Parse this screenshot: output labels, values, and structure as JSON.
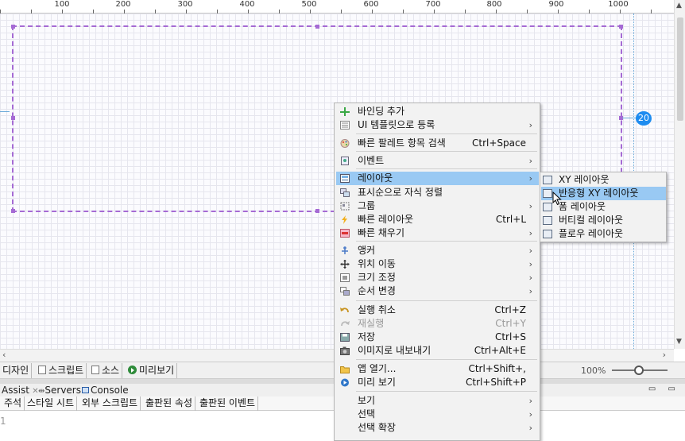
{
  "ruler": {
    "ticks": [
      "100",
      "200",
      "300",
      "400",
      "500",
      "600",
      "700",
      "800",
      "900",
      "1000"
    ]
  },
  "canvas": {
    "spacing_badge": "20"
  },
  "context_menu": {
    "groups": [
      [
        {
          "label": "바인딩 추가",
          "shortcut": "",
          "submenu": false,
          "icon": "plus-icon",
          "disabled": false
        },
        {
          "label": "UI 템플릿으로 등록",
          "shortcut": "",
          "submenu": true,
          "icon": "template-icon",
          "disabled": false
        }
      ],
      [
        {
          "label": "빠른 팔레트 항목 검색",
          "shortcut": "Ctrl+Space",
          "submenu": false,
          "icon": "palette-icon",
          "disabled": false
        }
      ],
      [
        {
          "label": "이벤트",
          "shortcut": "",
          "submenu": true,
          "icon": "event-icon",
          "disabled": false
        }
      ],
      [
        {
          "label": "레이아웃",
          "shortcut": "",
          "submenu": true,
          "icon": "layout-icon",
          "disabled": false,
          "highlighted": true
        },
        {
          "label": "표시순으로 자식 정렬",
          "shortcut": "",
          "submenu": false,
          "icon": "sort-icon",
          "disabled": false
        },
        {
          "label": "그룹",
          "shortcut": "",
          "submenu": true,
          "icon": "group-icon",
          "disabled": false
        },
        {
          "label": "빠른 레이아웃",
          "shortcut": "Ctrl+L",
          "submenu": false,
          "icon": "lightning-icon",
          "disabled": false
        },
        {
          "label": "빠른 채우기",
          "shortcut": "",
          "submenu": true,
          "icon": "fill-icon",
          "disabled": false
        }
      ],
      [
        {
          "label": "앵커",
          "shortcut": "",
          "submenu": true,
          "icon": "anchor-icon",
          "disabled": false
        },
        {
          "label": "위치 이동",
          "shortcut": "",
          "submenu": true,
          "icon": "move-icon",
          "disabled": false
        },
        {
          "label": "크기 조정",
          "shortcut": "",
          "submenu": true,
          "icon": "resize-icon",
          "disabled": false
        },
        {
          "label": "순서 변경",
          "shortcut": "",
          "submenu": true,
          "icon": "order-icon",
          "disabled": false
        }
      ],
      [
        {
          "label": "실행 취소",
          "shortcut": "Ctrl+Z",
          "submenu": false,
          "icon": "undo-icon",
          "disabled": false
        },
        {
          "label": "재실행",
          "shortcut": "Ctrl+Y",
          "submenu": false,
          "icon": "redo-icon",
          "disabled": true
        },
        {
          "label": "저장",
          "shortcut": "Ctrl+S",
          "submenu": false,
          "icon": "save-icon",
          "disabled": false
        },
        {
          "label": "이미지로 내보내기",
          "shortcut": "Ctrl+Alt+E",
          "submenu": false,
          "icon": "camera-icon",
          "disabled": false
        }
      ],
      [
        {
          "label": "앱 열기...",
          "shortcut": "Ctrl+Shift+,",
          "submenu": false,
          "icon": "folder-icon",
          "disabled": false
        },
        {
          "label": "미리 보기",
          "shortcut": "Ctrl+Shift+P",
          "submenu": false,
          "icon": "preview-icon",
          "disabled": false
        }
      ],
      [
        {
          "label": "보기",
          "shortcut": "",
          "submenu": true,
          "icon": "",
          "disabled": false
        },
        {
          "label": "선택",
          "shortcut": "",
          "submenu": true,
          "icon": "",
          "disabled": false
        },
        {
          "label": "선택 확장",
          "shortcut": "",
          "submenu": true,
          "icon": "",
          "disabled": false
        }
      ]
    ]
  },
  "layout_submenu": {
    "items": [
      {
        "label": "XY 레이아웃",
        "highlighted": false
      },
      {
        "label": "반응형 XY 레이아웃",
        "highlighted": true
      },
      {
        "label": "폼 레이아웃",
        "highlighted": false
      },
      {
        "label": "버티컬 레이아웃",
        "highlighted": false
      },
      {
        "label": "플로우 레이아웃",
        "highlighted": false
      }
    ]
  },
  "editor_tabs": {
    "design": "디자인",
    "script": "스크립트",
    "source": "소스",
    "preview": "미리보기",
    "zoom": "100%"
  },
  "view_tabs": {
    "assist": "Assist",
    "servers": "Servers",
    "console": "Console"
  },
  "property_tabs": [
    "주석",
    "스타일 시트",
    "외부 스크립트",
    "출판된 속성",
    "출판된 이벤트"
  ],
  "editor_pane": {
    "line_number": "1"
  },
  "colors": {
    "selection_border": "#a56ad4",
    "menu_highlight": "#99c9f3",
    "badge": "#1e8cf0"
  }
}
